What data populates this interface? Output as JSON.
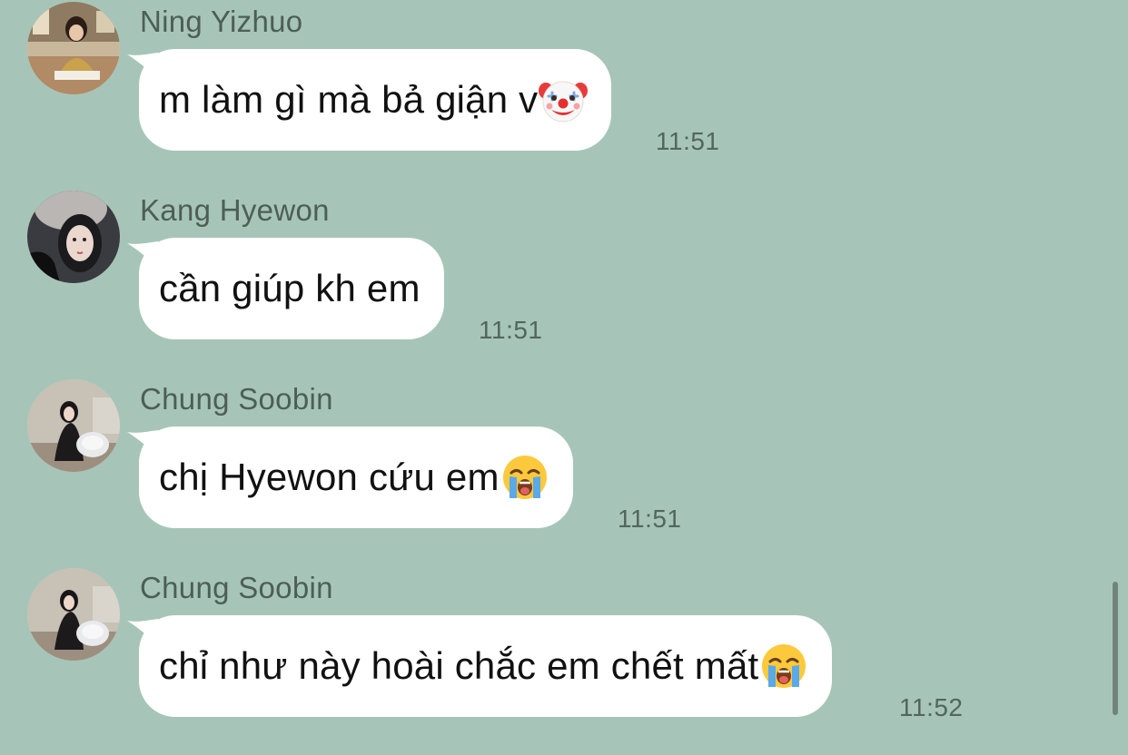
{
  "theme": {
    "background": "#a6c5b8",
    "bubble": "#ffffff",
    "name_color": "#4d5e57",
    "time_color": "#53655e"
  },
  "messages": [
    {
      "sender": "Ning Yizhuo",
      "text": "m làm gì mà bả giận v",
      "emoji": "clown-face-icon",
      "time": "11:51"
    },
    {
      "sender": "Kang Hyewon",
      "text": "cần giúp kh em",
      "emoji": null,
      "time": "11:51"
    },
    {
      "sender": "Chung Soobin",
      "text": "chị Hyewon cứu em",
      "emoji": "loudly-crying-face-icon",
      "time": "11:51"
    },
    {
      "sender": "Chung Soobin",
      "text": "chỉ như này hoài chắc em chết mất",
      "emoji": "loudly-crying-face-icon",
      "time": "11:52"
    }
  ]
}
